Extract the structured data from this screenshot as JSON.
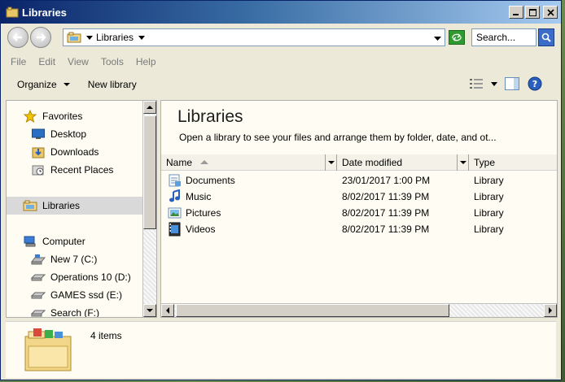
{
  "window": {
    "title": "Libraries"
  },
  "address": {
    "crumb": "Libraries",
    "search_placeholder": "Search..."
  },
  "menu": [
    "File",
    "Edit",
    "View",
    "Tools",
    "Help"
  ],
  "toolbar": {
    "organize": "Organize",
    "new_library": "New library"
  },
  "nav": {
    "favorites": "Favorites",
    "desktop": "Desktop",
    "downloads": "Downloads",
    "recent": "Recent Places",
    "libraries": "Libraries",
    "computer": "Computer",
    "drives": [
      "New 7 (C:)",
      "Operations 10 (D:)",
      "GAMES ssd (E:)",
      "Search (F:)"
    ]
  },
  "content": {
    "title": "Libraries",
    "subtitle": "Open a library to see your files and arrange them by folder, date, and ot...",
    "columns": {
      "name": "Name",
      "date": "Date modified",
      "type": "Type"
    },
    "rows": [
      {
        "name": "Documents",
        "date": "23/01/2017 1:00 PM",
        "type": "Library",
        "icon": "documents-icon"
      },
      {
        "name": "Music",
        "date": "8/02/2017 11:39 PM",
        "type": "Library",
        "icon": "music-icon"
      },
      {
        "name": "Pictures",
        "date": "8/02/2017 11:39 PM",
        "type": "Library",
        "icon": "pictures-icon"
      },
      {
        "name": "Videos",
        "date": "8/02/2017 11:39 PM",
        "type": "Library",
        "icon": "videos-icon"
      }
    ]
  },
  "details": {
    "count": "4 items"
  },
  "colors": {
    "title_bar_start": "#0a246a",
    "title_bar_end": "#a6caf0",
    "pane_bg": "#fffdf3",
    "selected_bg": "#d9d9d9"
  }
}
